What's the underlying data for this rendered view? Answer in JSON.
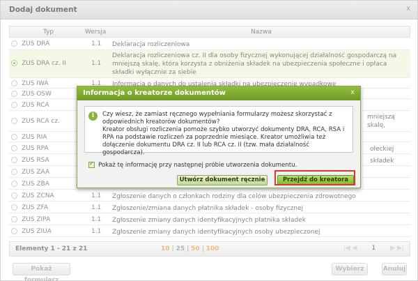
{
  "window": {
    "title": "Dodaj dokument",
    "close": "x"
  },
  "table": {
    "headers": {
      "typ": "Typ",
      "wersja": "Wersja",
      "nazwa": "Nazwa"
    },
    "rows": [
      {
        "typ": "ZUS DRA",
        "ver": "1.1",
        "name": "Deklaracja rozliczeniowa"
      },
      {
        "typ": "ZUS DRA cz. II",
        "ver": "1.1",
        "name": "Deklaracja rozliczeniowa cz. II dla osoby fizycznej wykonującej działalność gospodarczą na mniejszą skalę, która korzysta z obniżenia składek na ubezpieczenia społeczne i opłaca składki wyłącznie za siebie"
      },
      {
        "typ": "ZUS IWA",
        "ver": "1.1",
        "name": "Informacja o danych do ustalenia składki na ubezpieczenie wypadkowe"
      },
      {
        "typ": "ZUS OSW",
        "ver": "",
        "name": ""
      },
      {
        "typ": "ZUS RCA",
        "ver": "",
        "name": ""
      },
      {
        "typ": "ZUS RCA cz.",
        "ver": "",
        "name": "mniejszą skalę,"
      },
      {
        "typ": "ZUS RIA",
        "ver": "",
        "name": ""
      },
      {
        "typ": "ZUS RPA",
        "ver": "",
        "name": "ołeckiej"
      },
      {
        "typ": "ZUS RSA",
        "ver": "",
        "name": "składek"
      },
      {
        "typ": "ZUS ZAA",
        "ver": "",
        "name": ""
      },
      {
        "typ": "ZUS ZBA",
        "ver": "",
        "name": ""
      },
      {
        "typ": "ZUS ZCNA",
        "ver": "1.1",
        "name": "Zgłoszenie danych o członkach rodziny dla celów ubezpieczenia zdrowotnego"
      },
      {
        "typ": "ZUS ZFA",
        "ver": "1.1",
        "name": "Zgłoszenie/zmiana danych płatnika składek - osoby fizycznej"
      },
      {
        "typ": "ZUS ZIPA",
        "ver": "1.1",
        "name": "Zgłoszenie zmiany danych identyfikacyjnych płatnika składek"
      },
      {
        "typ": "ZUS ZIUA",
        "ver": "1.1",
        "name": "Zgłoszenie zmiany danych identyfikacyjnych osoby ubezpieczonej"
      }
    ]
  },
  "footer": {
    "count": "Elementy 1 - 21 z 21",
    "page_sizes": [
      "10",
      "25",
      "50",
      "100"
    ],
    "page": "1",
    "nav_first": "|◀",
    "nav_prev": "◀",
    "nav_next": "▶",
    "nav_last": "▶|"
  },
  "buttons": {
    "show_form": "Pokaż formularz",
    "select": "Wybierz",
    "cancel": "Anuluj"
  },
  "modal": {
    "title": "Informacja o kreatorze dokumentów",
    "close": "x",
    "info_icon": "i",
    "line1": "Czy wiesz, że zamiast ręcznego wypełniania formularzy możesz skorzystać z odpowiednich kreatorów dokumentów?",
    "line2": "Kreator obsługi rozliczenia pomoże szybko utworzyć dokumenty DRA, RCA, RSA i RPA na podstawie rozliczeń za poprzednie miesiące. Kreator umożliwia też dołączenie dokumentu DRA cz. II lub RCA cz. II (tzw. mała działalność gospodarcza).",
    "checkbox_label": "Pokaż tę informację przy następnej próbie utworzenia dokumentu.",
    "checkbox_checked": true,
    "btn_manual": "Utwórz dokument ręcznie",
    "btn_wizard": "Przejdź do kreatora"
  },
  "colors": {
    "accent": "#7aa52c",
    "highlight": "#d73a2e",
    "pager": "#e49a2c"
  }
}
